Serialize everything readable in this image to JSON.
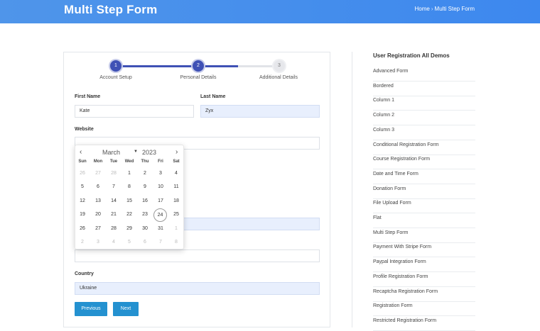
{
  "header": {
    "title": "Multi Step Form",
    "breadcrumb_home": "Home",
    "breadcrumb_current": "Multi Step Form"
  },
  "stepper": {
    "steps": [
      {
        "number": "1",
        "label": "Account Setup"
      },
      {
        "number": "2",
        "label": "Personal Details"
      },
      {
        "number": "3",
        "label": "Additional Details"
      }
    ]
  },
  "form": {
    "first_name_label": "First Name",
    "first_name_value": "Kate",
    "last_name_label": "Last Name",
    "last_name_value": "Zyx",
    "website_label": "Website",
    "website_value": "",
    "country_label": "Country",
    "country_value": "Ukraine",
    "previous_label": "Previous",
    "next_label": "Next"
  },
  "datepicker": {
    "month": "March",
    "year": "2023",
    "weekdays": [
      "Sun",
      "Mon",
      "Tue",
      "Wed",
      "Thu",
      "Fri",
      "Sat"
    ],
    "weeks": [
      [
        "26",
        "27",
        "28",
        "1",
        "2",
        "3",
        "4"
      ],
      [
        "5",
        "6",
        "7",
        "8",
        "9",
        "10",
        "11"
      ],
      [
        "12",
        "13",
        "14",
        "15",
        "16",
        "17",
        "18"
      ],
      [
        "19",
        "20",
        "21",
        "22",
        "23",
        "24",
        "25"
      ],
      [
        "26",
        "27",
        "28",
        "29",
        "30",
        "31",
        "1"
      ],
      [
        "2",
        "3",
        "4",
        "5",
        "6",
        "7",
        "8"
      ]
    ],
    "today": "24"
  },
  "sidebar": {
    "title": "User Registration All Demos",
    "items": [
      "Advanced Form",
      "Bordered",
      "Column 1",
      "Column 2",
      "Column 3",
      "Conditional Registration Form",
      "Course Registration Form",
      "Date and Time Form",
      "Donation Form",
      "File Upload Form",
      "Flat",
      "Multi Step Form",
      "Payment With Stripe Form",
      "Paypal Integration Form",
      "Profile Registration Form",
      "Recaptcha Registration Form",
      "Registration Form",
      "Restricted Registration Form"
    ]
  },
  "colors": {
    "header": "#3d88ee",
    "step_active": "#3f51b5",
    "button": "#2491d0",
    "filled_input": "#e8effd"
  }
}
